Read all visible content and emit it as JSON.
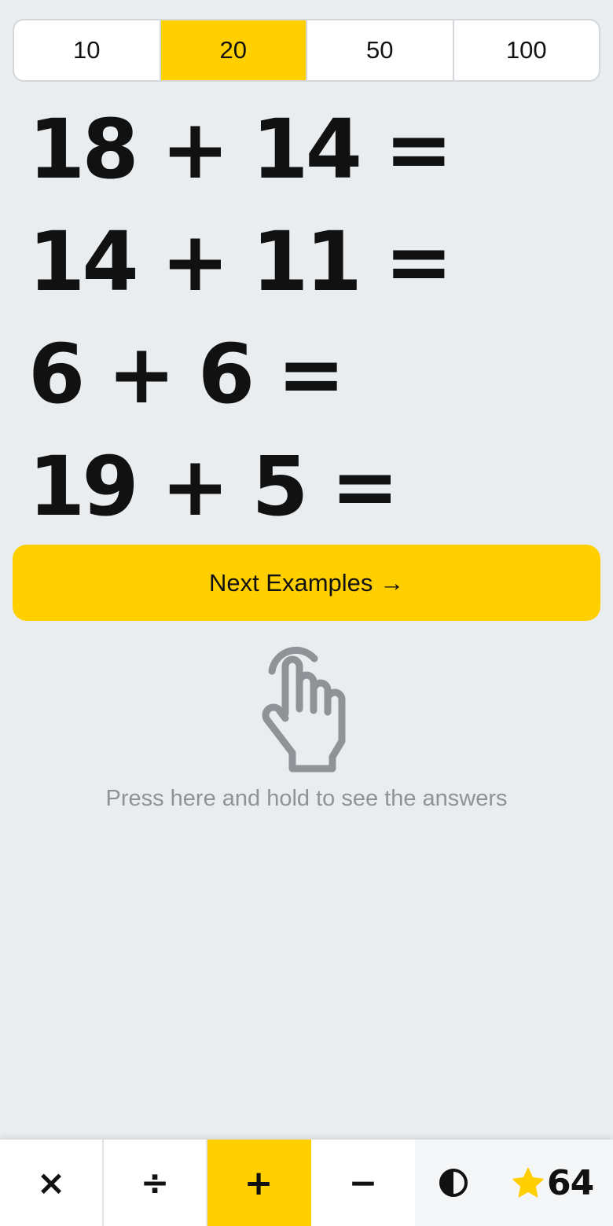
{
  "range_options": [
    {
      "label": "10",
      "active": false
    },
    {
      "label": "20",
      "active": true
    },
    {
      "label": "50",
      "active": false
    },
    {
      "label": "100",
      "active": false
    }
  ],
  "examples": [
    "18 + 14 =",
    "14 + 11 =",
    "6 + 6 =",
    "19 + 5 ="
  ],
  "next_button_label": "Next Examples →",
  "reveal": {
    "icon": "hand-pointer-icon",
    "text": "Press here and hold to see the answers"
  },
  "operations": [
    {
      "symbol": "×",
      "name": "multiply",
      "active": false
    },
    {
      "symbol": "÷",
      "name": "divide",
      "active": false
    },
    {
      "symbol": "+",
      "name": "add",
      "active": true
    },
    {
      "symbol": "−",
      "name": "subtract",
      "active": false
    }
  ],
  "tools": {
    "contrast_icon": "contrast-icon",
    "star_icon": "star-icon",
    "score": "64"
  },
  "colors": {
    "accent": "#ffcf00",
    "background": "#eaedf0",
    "text": "#111111",
    "muted": "#8f9296",
    "star": "#ffcf00"
  }
}
